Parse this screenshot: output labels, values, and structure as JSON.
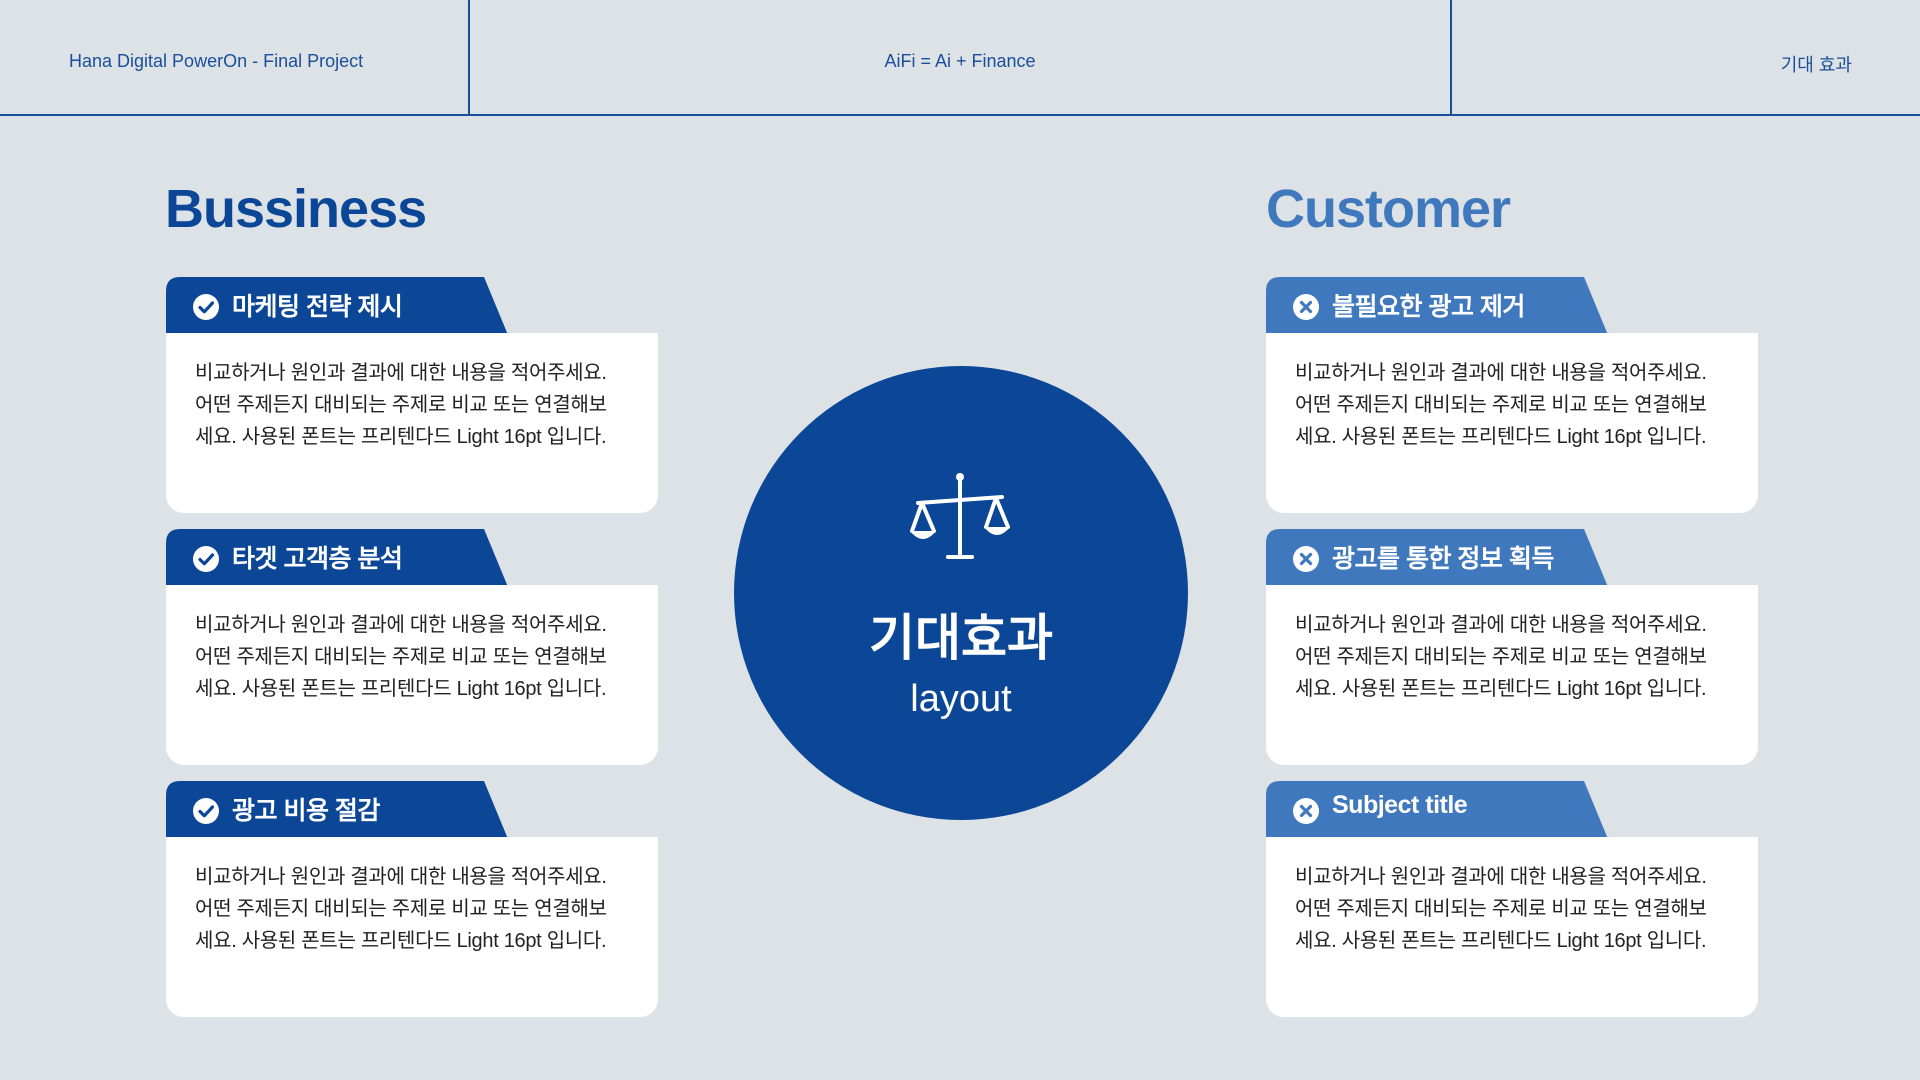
{
  "header": {
    "left": "Hana Digital PowerOn -  Final Project",
    "center": "AiFi  = Ai + Finance",
    "right": "기대 효과"
  },
  "left_section": {
    "title": "Bussiness",
    "color": "#0b4697",
    "icon": "check-circle-icon",
    "cards": [
      {
        "title": "마케팅 전략 제시",
        "lines": [
          "비교하거나 원인과 결과에 대한 내용을 적어주세요.",
          "어떤 주제든지 대비되는 주제로 비교 또는 연결해보",
          "세요. 사용된 폰트는 프리텐다드 Light 16pt 입니다."
        ]
      },
      {
        "title": "타겟 고객층 분석",
        "lines": [
          "비교하거나 원인과 결과에 대한 내용을 적어주세요.",
          "어떤 주제든지 대비되는 주제로 비교 또는 연결해보",
          "세요. 사용된 폰트는 프리텐다드 Light 16pt 입니다."
        ]
      },
      {
        "title": "광고 비용 절감",
        "lines": [
          "비교하거나 원인과 결과에 대한 내용을 적어주세요.",
          "어떤 주제든지 대비되는 주제로 비교 또는 연결해보",
          "세요. 사용된 폰트는 프리텐다드 Light 16pt 입니다."
        ]
      }
    ]
  },
  "right_section": {
    "title": "Customer",
    "color": "#3f78bc",
    "icon": "x-circle-icon",
    "cards": [
      {
        "title": "불필요한 광고 제거",
        "lines": [
          "비교하거나 원인과 결과에 대한 내용을 적어주세요.",
          "어떤 주제든지 대비되는 주제로 비교 또는 연결해보",
          "세요. 사용된 폰트는 프리텐다드 Light 16pt 입니다."
        ]
      },
      {
        "title": "광고를 통한 정보 획득",
        "lines": [
          "비교하거나 원인과 결과에 대한 내용을 적어주세요.",
          "어떤 주제든지 대비되는 주제로 비교 또는 연결해보",
          "세요. 사용된 폰트는 프리텐다드 Light 16pt 입니다."
        ]
      },
      {
        "title": "Subject title",
        "lines": [
          "비교하거나 원인과 결과에 대한 내용을 적어주세요.",
          "어떤 주제든지 대비되는 주제로 비교 또는 연결해보",
          "세요. 사용된 폰트는 프리텐다드 Light 16pt 입니다."
        ]
      }
    ]
  },
  "center": {
    "icon": "balance-scale-icon",
    "title": "기대효과",
    "subtitle": "layout",
    "color": "#0b4697"
  }
}
